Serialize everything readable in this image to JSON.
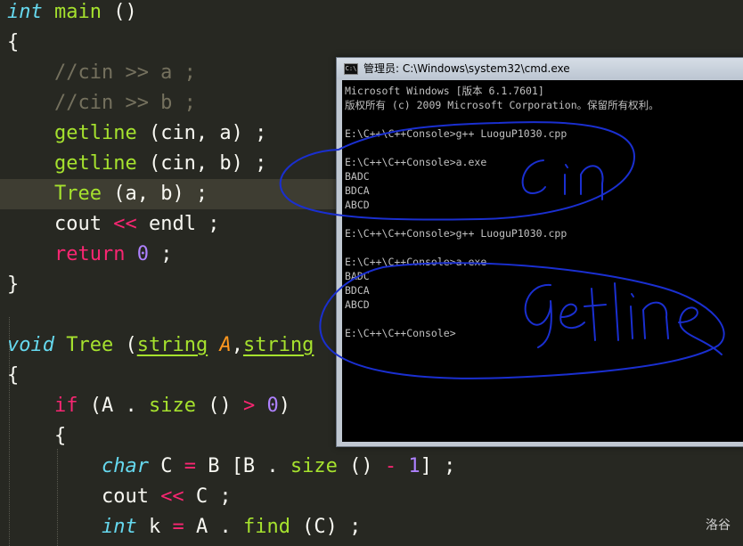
{
  "editor": {
    "lines": [
      [
        {
          "t": "int",
          "c": "kw"
        },
        {
          "t": " main ",
          "c": "fn"
        },
        {
          "t": "()",
          "c": "plain"
        }
      ],
      [
        {
          "t": "{",
          "c": "brace"
        }
      ],
      [
        {
          "t": "    //cin >> a ;",
          "c": "cm"
        }
      ],
      [
        {
          "t": "    //cin >> b ;",
          "c": "cm"
        }
      ],
      [
        {
          "t": "    ",
          "c": "plain"
        },
        {
          "t": "getline",
          "c": "fn"
        },
        {
          "t": " (cin, a) ;",
          "c": "plain"
        }
      ],
      [
        {
          "t": "    ",
          "c": "plain"
        },
        {
          "t": "getline",
          "c": "fn"
        },
        {
          "t": " (cin, b) ;",
          "c": "plain"
        }
      ],
      [
        {
          "t": "    ",
          "c": "plain"
        },
        {
          "t": "Tree",
          "c": "fn"
        },
        {
          "t": " (a, b) ;",
          "c": "plain"
        }
      ],
      [
        {
          "t": "    cout ",
          "c": "plain"
        },
        {
          "t": "<<",
          "c": "op"
        },
        {
          "t": " endl ;",
          "c": "plain"
        }
      ],
      [
        {
          "t": "    ",
          "c": "plain"
        },
        {
          "t": "return",
          "c": "kw2"
        },
        {
          "t": " ",
          "c": "plain"
        },
        {
          "t": "0",
          "c": "num"
        },
        {
          "t": " ;",
          "c": "plain"
        }
      ],
      [
        {
          "t": "}",
          "c": "brace"
        }
      ],
      [],
      [
        {
          "t": "void",
          "c": "kw"
        },
        {
          "t": " Tree ",
          "c": "fn"
        },
        {
          "t": "(",
          "c": "plain"
        },
        {
          "t": "string",
          "c": "type"
        },
        {
          "t": " ",
          "c": "plain"
        },
        {
          "t": "A",
          "c": "param"
        },
        {
          "t": ",",
          "c": "plain"
        },
        {
          "t": "string",
          "c": "type"
        }
      ],
      [
        {
          "t": "{",
          "c": "plain"
        }
      ],
      [
        {
          "t": "    ",
          "c": "plain"
        },
        {
          "t": "if",
          "c": "kw2"
        },
        {
          "t": " (A . ",
          "c": "plain"
        },
        {
          "t": "size",
          "c": "fn"
        },
        {
          "t": " () ",
          "c": "plain"
        },
        {
          "t": ">",
          "c": "op"
        },
        {
          "t": " ",
          "c": "plain"
        },
        {
          "t": "0",
          "c": "num"
        },
        {
          "t": ")",
          "c": "plain"
        }
      ],
      [
        {
          "t": "    {",
          "c": "plain"
        }
      ],
      [
        {
          "t": "        ",
          "c": "plain"
        },
        {
          "t": "char",
          "c": "kw"
        },
        {
          "t": " C ",
          "c": "plain"
        },
        {
          "t": "=",
          "c": "op"
        },
        {
          "t": " B [B . ",
          "c": "plain"
        },
        {
          "t": "size",
          "c": "fn"
        },
        {
          "t": " () ",
          "c": "plain"
        },
        {
          "t": "-",
          "c": "op"
        },
        {
          "t": " ",
          "c": "plain"
        },
        {
          "t": "1",
          "c": "num"
        },
        {
          "t": "] ;",
          "c": "plain"
        }
      ],
      [
        {
          "t": "        cout ",
          "c": "plain"
        },
        {
          "t": "<<",
          "c": "op"
        },
        {
          "t": " C ;",
          "c": "plain"
        }
      ],
      [
        {
          "t": "        ",
          "c": "plain"
        },
        {
          "t": "int",
          "c": "kw"
        },
        {
          "t": " k ",
          "c": "plain"
        },
        {
          "t": "=",
          "c": "op"
        },
        {
          "t": " A . ",
          "c": "plain"
        },
        {
          "t": "find",
          "c": "fn"
        },
        {
          "t": " (C) ;",
          "c": "plain"
        }
      ]
    ]
  },
  "cmd": {
    "title": "管理员: C:\\Windows\\system32\\cmd.exe",
    "lines": [
      "Microsoft Windows [版本 6.1.7601]",
      "版权所有 (c) 2009 Microsoft Corporation。保留所有权利。",
      "",
      "E:\\C++\\C++Console>g++ LuoguP1030.cpp",
      "",
      "E:\\C++\\C++Console>a.exe",
      "BADC",
      "BDCA",
      "ABCD",
      "",
      "E:\\C++\\C++Console>g++ LuoguP1030.cpp",
      "",
      "E:\\C++\\C++Console>a.exe",
      "BADC",
      "BDCA",
      "ABCD",
      "",
      "E:\\C++\\C++Console>"
    ]
  },
  "annotations": {
    "first": "cin",
    "second": "getline",
    "ink_color": "#1a2fd0"
  },
  "watermark": "洛谷"
}
